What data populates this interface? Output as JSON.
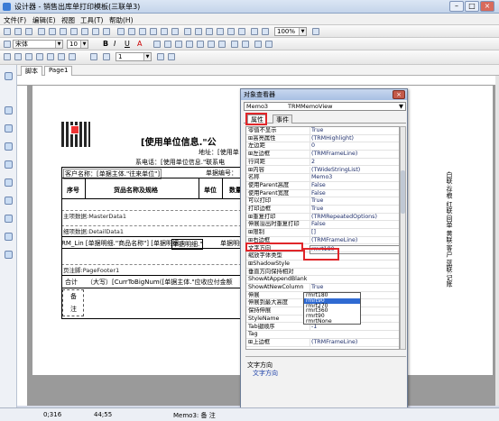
{
  "window": {
    "title": "设计器 - 销售出库单打印模板(三联单3)",
    "min": "–",
    "max": "□",
    "close": "×"
  },
  "menu": [
    "文件(F)",
    "编辑(E)",
    "视图",
    "工具(T)",
    "帮助(H)"
  ],
  "toolbar": {
    "font": "宋体",
    "size": "10",
    "zoom": "100%",
    "bold": "B",
    "italic": "I",
    "underline": "U",
    "fontcolor": "A",
    "width": "1"
  },
  "tabs": [
    "脚本",
    "Page1"
  ],
  "report": {
    "header_title": "[使用单位信息.\"公",
    "addr": "地址：[使用单",
    "contact": "系电话：[使用单位信息.\"联系电",
    "customer": "客户名称：[单据主体.\"往来单位\"]",
    "docno": "单据编号：",
    "col_seq": "序号",
    "col_name": "货品名称及规格",
    "col_unit": "单位",
    "col_qty": "数量",
    "band_master": "主项数据:MasterData1",
    "band_detail": "细项数据:DetailData1",
    "detail_row": "RM_Lin [单据明细.\"商品名称\"]  [单据明细.\"",
    "detail_mid": "单据明细.\"",
    "detail_mid2": "单据明细.\"",
    "band_footer": "页注脚:PageFooter1",
    "total_label": "合计",
    "total_text": "（大写）[CurrToBigNum([单据主体.\"应收应付金额",
    "remark1": "备",
    "remark2": "注"
  },
  "right_labels": [
    "白联:存根",
    "红联:回单",
    "黄联:客户",
    "蓝联:记账"
  ],
  "inspector": {
    "title": "对象查看器",
    "close": "×",
    "object": "Memo3",
    "object_type": "TRMMemoView",
    "tab_props": "属性",
    "tab_events": "事件",
    "rows": [
      {
        "n": "零值不显示",
        "v": "True"
      },
      {
        "n": "⊞高亮属性",
        "v": "(TRMHighlight)"
      },
      {
        "n": "左边距",
        "v": "0"
      },
      {
        "n": "⊞左边框",
        "v": "(TRMFrameLine)"
      },
      {
        "n": "行间距",
        "v": "2"
      },
      {
        "n": "⊞内容",
        "v": "(TWideStringList)"
      },
      {
        "n": "名称",
        "v": "Memo3"
      },
      {
        "n": "使用Parent高度",
        "v": "False"
      },
      {
        "n": "使用Parent宽度",
        "v": "False"
      },
      {
        "n": "可以打印",
        "v": "True"
      },
      {
        "n": "打印边框",
        "v": "True"
      },
      {
        "n": "⊞重复打印",
        "v": "(TRMRepeatedOptions)"
      },
      {
        "n": "伸展溢出时重复打印",
        "v": "False"
      },
      {
        "n": "⊞限制",
        "v": "[]"
      },
      {
        "n": "⊞右边框",
        "v": "(TRMFrameLine)"
      },
      {
        "n": "文字方向",
        "v": "rmrt180"
      },
      {
        "n": "缩放字体类型",
        "v": ""
      },
      {
        "n": "⊞ShadowStyle",
        "v": ""
      },
      {
        "n": "垂直方向保持相对",
        "v": ""
      },
      {
        "n": "ShowAtAppendBlank",
        "v": ""
      },
      {
        "n": "ShowAtNewColumn",
        "v": "True"
      },
      {
        "n": "伸展",
        "v": "False"
      },
      {
        "n": "伸展到最大高度",
        "v": "False"
      },
      {
        "n": "保持伸展",
        "v": ""
      },
      {
        "n": "StyleName",
        "v": ""
      },
      {
        "n": "Tab键顺序",
        "v": "-1"
      },
      {
        "n": "Tag",
        "v": ""
      },
      {
        "n": "⊞上边框",
        "v": "(TRMFrameLine)"
      }
    ],
    "dropdown": [
      "rmrt180",
      "rmrt90",
      "rmrt270",
      "rmrt360",
      "rmrt90",
      "rmrtNone"
    ],
    "desc_title": "文字方向",
    "desc_text": "文字方向"
  },
  "status": {
    "pos": "0;316",
    "size": "44;55",
    "memo": "Memo3: 备 注"
  }
}
